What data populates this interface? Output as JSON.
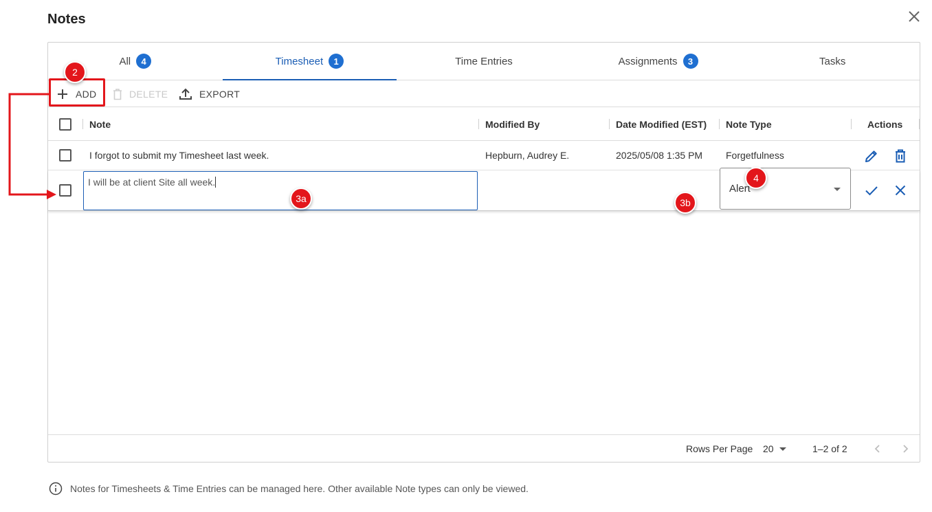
{
  "dialog": {
    "title": "Notes"
  },
  "tabs": [
    {
      "label": "All",
      "badge": "4"
    },
    {
      "label": "Timesheet",
      "badge": "1",
      "active": true
    },
    {
      "label": "Time Entries",
      "badge": ""
    },
    {
      "label": "Assignments",
      "badge": "3"
    },
    {
      "label": "Tasks",
      "badge": ""
    }
  ],
  "toolbar": {
    "add_label": "ADD",
    "delete_label": "DELETE",
    "export_label": "EXPORT"
  },
  "columns": {
    "note": "Note",
    "modified_by": "Modified By",
    "date_modified": "Date Modified (EST)",
    "note_type": "Note Type",
    "actions": "Actions"
  },
  "rows": [
    {
      "note": "I forgot to submit my Timesheet last week.",
      "modified_by": "Hepburn, Audrey E.",
      "date_modified": "2025/05/08 1:35 PM",
      "note_type": "Forgetfulness"
    }
  ],
  "new_row": {
    "note_value": "I will be at client Site all week.",
    "note_type_value": "Alert"
  },
  "footer": {
    "rows_per_page_label": "Rows Per Page",
    "rows_per_page_value": "20",
    "range": "1–2 of 2"
  },
  "info_text": "Notes for Timesheets & Time Entries can be managed here. Other available Note types can only be viewed.",
  "markers": {
    "m2": "2",
    "m3a": "3a",
    "m3b": "3b",
    "m4": "4"
  },
  "colors": {
    "accent": "#1a5db4",
    "badge": "#1f6fd1",
    "annotation_red": "#e3161b"
  }
}
